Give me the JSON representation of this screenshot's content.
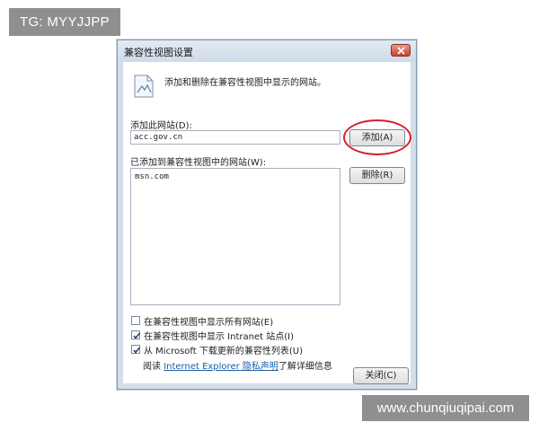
{
  "watermark": {
    "top_left": "TG: MYYJJPP",
    "bottom_right": "www.chunqiuqipai.com"
  },
  "dialog": {
    "title": "兼容性视图设置",
    "description": "添加和删除在兼容性视图中显示的网站。",
    "add_site_label": "添加此网站(D):",
    "add_site_value": "acc.gov.cn",
    "add_button": "添加(A)",
    "added_sites_label": "已添加到兼容性视图中的网站(W):",
    "sites": [
      "msn.com"
    ],
    "remove_button": "删除(R)",
    "options": [
      {
        "label": "在兼容性视图中显示所有网站(E)",
        "checked": false
      },
      {
        "label": "在兼容性视图中显示 Intranet 站点(I)",
        "checked": true
      },
      {
        "label": "从 Microsoft 下载更新的兼容性列表(U)",
        "checked": true
      }
    ],
    "read_prefix": "阅读",
    "privacy_link": "Internet Explorer 隐私声明",
    "read_suffix": "了解详细信息",
    "close_button": "关闭(C)"
  },
  "colors": {
    "highlight_ring": "#d2202a",
    "link": "#1a5ea8",
    "watermark_bg": "#8f8f8f"
  },
  "icons": {
    "title_close": "close-icon",
    "header": "document-image-icon"
  }
}
